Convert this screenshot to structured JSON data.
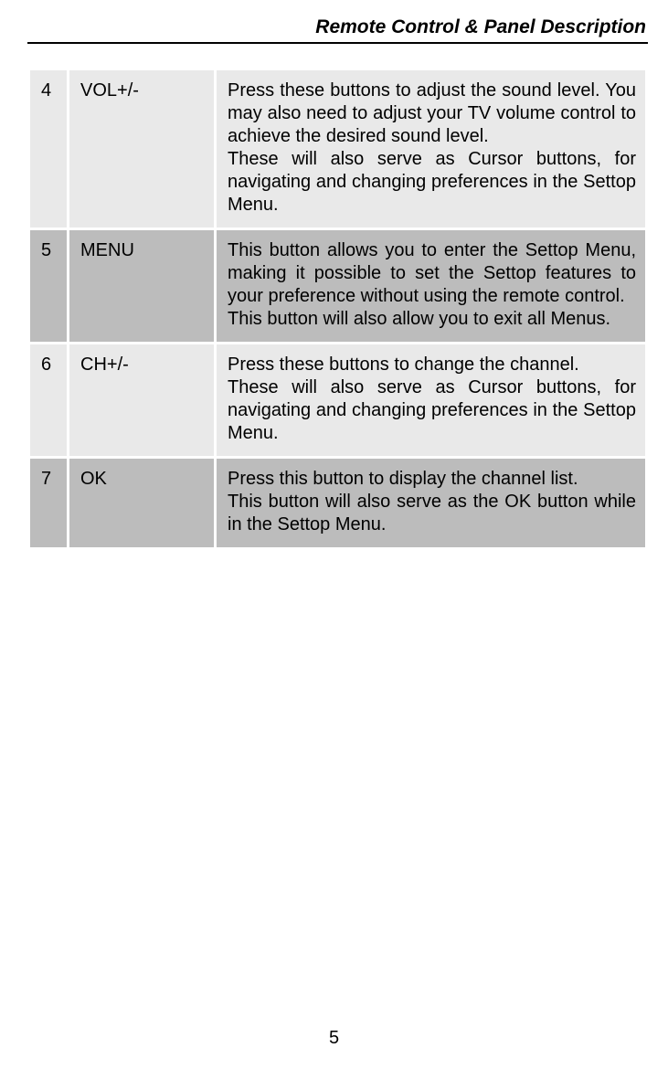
{
  "header": {
    "title": "Remote Control & Panel Description"
  },
  "rows": [
    {
      "num": "4",
      "name": "VOL+/-",
      "desc_p1": "Press these buttons to adjust the sound level.   You may also need to adjust your TV volume control to achieve the desired sound level.",
      "desc_p2": "These will also serve as Cursor buttons, for navigating and changing preferences in the Settop Menu."
    },
    {
      "num": "5",
      "name": "MENU",
      "desc_p1": "This button allows you to enter the Settop Menu, making it possible to set the Settop features to your preference without using the remote control.",
      "desc_p2": "This button will also allow you to exit all Menus."
    },
    {
      "num": "6",
      "name": "CH+/-",
      "desc_p1": "Press these buttons to change the channel.",
      "desc_p2": "These will also serve as Cursor buttons, for navigating and changing preferences in the Settop Menu."
    },
    {
      "num": "7",
      "name": "OK",
      "desc_p1": "Press this button to display the channel list.",
      "desc_p2": "This button will also serve as the OK button while in the Settop Menu."
    }
  ],
  "page_number": "5"
}
